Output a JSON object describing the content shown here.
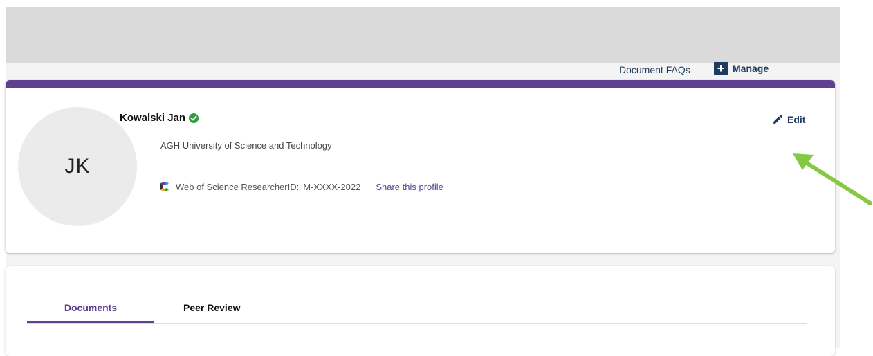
{
  "profile": {
    "initials": "JK",
    "name": "Kowalski Jan",
    "verified": true,
    "affiliation": "AGH University of Science and Technology",
    "researcher_id_label": "Web of Science ResearcherID:",
    "researcher_id_value": "M-XXXX-2022",
    "share_label": "Share this profile",
    "edit_label": "Edit"
  },
  "tabs": [
    {
      "label": "Documents",
      "active": true
    },
    {
      "label": "Peer Review",
      "active": false
    }
  ],
  "actions": {
    "faqs_label": "Document FAQs",
    "manage_label": "Manage"
  },
  "colors": {
    "accent": "#5e3f91",
    "verified": "#2e9e3f",
    "navy": "#1f3a5f",
    "annotation_arrow": "#86c843"
  },
  "icons": {
    "verified": "check-badge-icon",
    "wos": "web-of-science-logo-icon",
    "edit": "pencil-icon",
    "manage": "plus-square-icon"
  }
}
